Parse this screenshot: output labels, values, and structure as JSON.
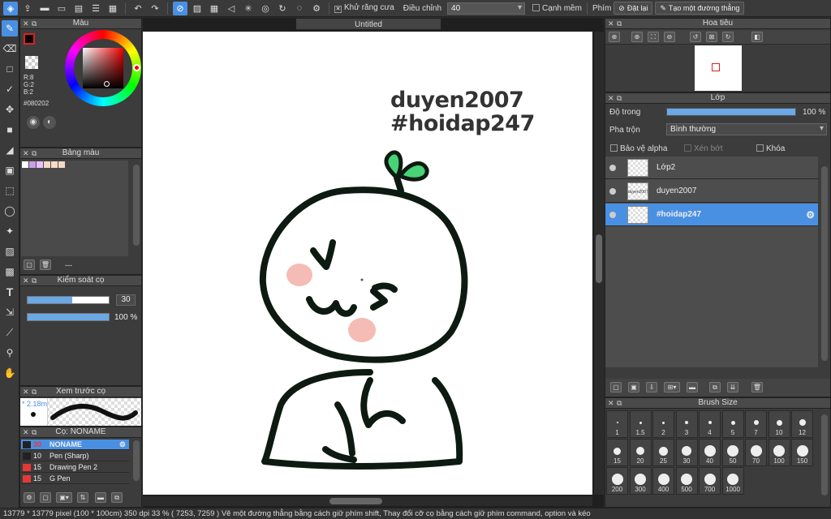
{
  "toolbar": {
    "antialias_label": "Khử răng cưa",
    "adjust_label": "Điều chỉnh",
    "adjust_value": "40",
    "smooth_edge_label": "Cạnh mềm",
    "key_label": "Phím",
    "reset_label": "Đặt lại",
    "straight_line_label": "Tạo một đường thẳng"
  },
  "document": {
    "tab_title": "Untitled",
    "text_line1": "duyen2007",
    "text_line2": "#hoidap247"
  },
  "color_panel": {
    "title": "Màu",
    "r": "R:8",
    "g": "G:2",
    "b": "B:2",
    "hex": "#080202",
    "foreground": "#080202"
  },
  "palette_panel": {
    "title": "Bảng màu",
    "swatches": [
      "#ffffff",
      "#c9a0e8",
      "#e8c0ff",
      "#f7d7c6",
      "#f9dcc8",
      "#f7d8c4"
    ],
    "name": "---"
  },
  "brush_control": {
    "title": "Kiểm soát cọ",
    "size_value": "30",
    "size_fill": 0.55,
    "opacity_value": "100 %",
    "opacity_fill": 1.0
  },
  "brush_preview": {
    "title": "Xem trước cọ",
    "size_label": "* 2.18m"
  },
  "brush_list": {
    "title": "Cọ: NONAME",
    "items": [
      {
        "size": "30",
        "name": "NONAME",
        "color": "#222222",
        "selected": true
      },
      {
        "size": "10",
        "name": "Pen (Sharp)",
        "color": "#222222",
        "selected": false
      },
      {
        "size": "15",
        "name": "Drawing Pen 2",
        "color": "#e53935",
        "selected": false
      },
      {
        "size": "15",
        "name": "G Pen",
        "color": "#e53935",
        "selected": false
      }
    ]
  },
  "navigator": {
    "title": "Hoa tiêu"
  },
  "layers": {
    "title": "Lớp",
    "opacity_label": "Độ trong",
    "opacity_value": "100 %",
    "blend_label": "Pha trộn",
    "blend_value": "Bình thường",
    "protect_alpha_label": "Bảo vệ alpha",
    "clipping_label": "Xén bớt",
    "lock_label": "Khóa",
    "items": [
      {
        "name": "Lớp2",
        "selected": false,
        "thumb": ""
      },
      {
        "name": "duyen2007",
        "selected": false,
        "thumb": "duyen2007"
      },
      {
        "name": "#hoidap247",
        "selected": true,
        "thumb": ""
      }
    ]
  },
  "brush_size": {
    "title": "Brush Size",
    "sizes": [
      "1",
      "1.5",
      "2",
      "3",
      "4",
      "5",
      "7",
      "10",
      "12",
      "15",
      "20",
      "25",
      "30",
      "40",
      "50",
      "70",
      "100",
      "150",
      "200",
      "300",
      "400",
      "500",
      "700",
      "1000"
    ]
  },
  "status": {
    "text": "13779 * 13779 pixel   (100 * 100cm)    350 dpi    33 %    ( 7253, 7259 )    Vẽ một đường thẳng bằng cách giữ phím shift, Thay đổi cỡ cọ bằng cách giữ phím command, option và kéo"
  }
}
